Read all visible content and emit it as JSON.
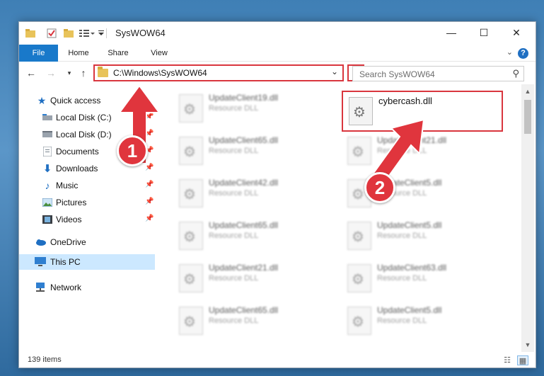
{
  "window": {
    "title": "SysWOW64",
    "controls": {
      "minimize": "—",
      "maximize": "☐",
      "close": "✕"
    }
  },
  "ribbon": {
    "tabs": [
      "File",
      "Home",
      "Share",
      "View"
    ],
    "collapse": "⌄",
    "help": "?"
  },
  "address_bar": {
    "path": "C:\\Windows\\SysWOW64",
    "search_placeholder": "Search SysWOW64"
  },
  "nav": {
    "quick_access": "Quick access",
    "items": [
      {
        "label": "Local Disk (C:)",
        "icon": "drive-icon",
        "pinned": true
      },
      {
        "label": "Local Disk (D:)",
        "icon": "drive-icon",
        "pinned": true
      },
      {
        "label": "Documents",
        "icon": "documents-icon",
        "pinned": true
      },
      {
        "label": "Downloads",
        "icon": "downloads-icon",
        "pinned": true
      },
      {
        "label": "Music",
        "icon": "music-icon",
        "pinned": true
      },
      {
        "label": "Pictures",
        "icon": "pictures-icon",
        "pinned": true
      },
      {
        "label": "Videos",
        "icon": "videos-icon",
        "pinned": true
      }
    ],
    "onedrive": "OneDrive",
    "this_pc": "This PC",
    "network": "Network"
  },
  "files": {
    "left_column": [
      {
        "name": "UpdateClient19.dll",
        "type": "Resource DLL"
      },
      {
        "name": "UpdateClient65.dll",
        "type": "Resource DLL"
      },
      {
        "name": "UpdateClient42.dll",
        "type": "Resource DLL"
      },
      {
        "name": "UpdateClient65.dll",
        "type": "Resource DLL"
      },
      {
        "name": "UpdateClient21.dll",
        "type": "Resource DLL"
      },
      {
        "name": "UpdateClient65.dll",
        "type": "Resource DLL"
      }
    ],
    "right_column": [
      {
        "name": "cybercash.dll",
        "type": ""
      },
      {
        "name": "UpdateClient21.dll",
        "type": "Resource DLL"
      },
      {
        "name": "UpdateClient5.dll",
        "type": "Resource DLL"
      },
      {
        "name": "UpdateClient5.dll",
        "type": "Resource DLL"
      },
      {
        "name": "UpdateClient63.dll",
        "type": "Resource DLL"
      },
      {
        "name": "UpdateClient5.dll",
        "type": "Resource DLL"
      }
    ]
  },
  "status": {
    "item_count": "139 items"
  },
  "annotations": {
    "step1": "1",
    "step2": "2"
  },
  "colors": {
    "accent": "#1979ca",
    "highlight": "#d9363e",
    "selected": "#cce8ff"
  }
}
